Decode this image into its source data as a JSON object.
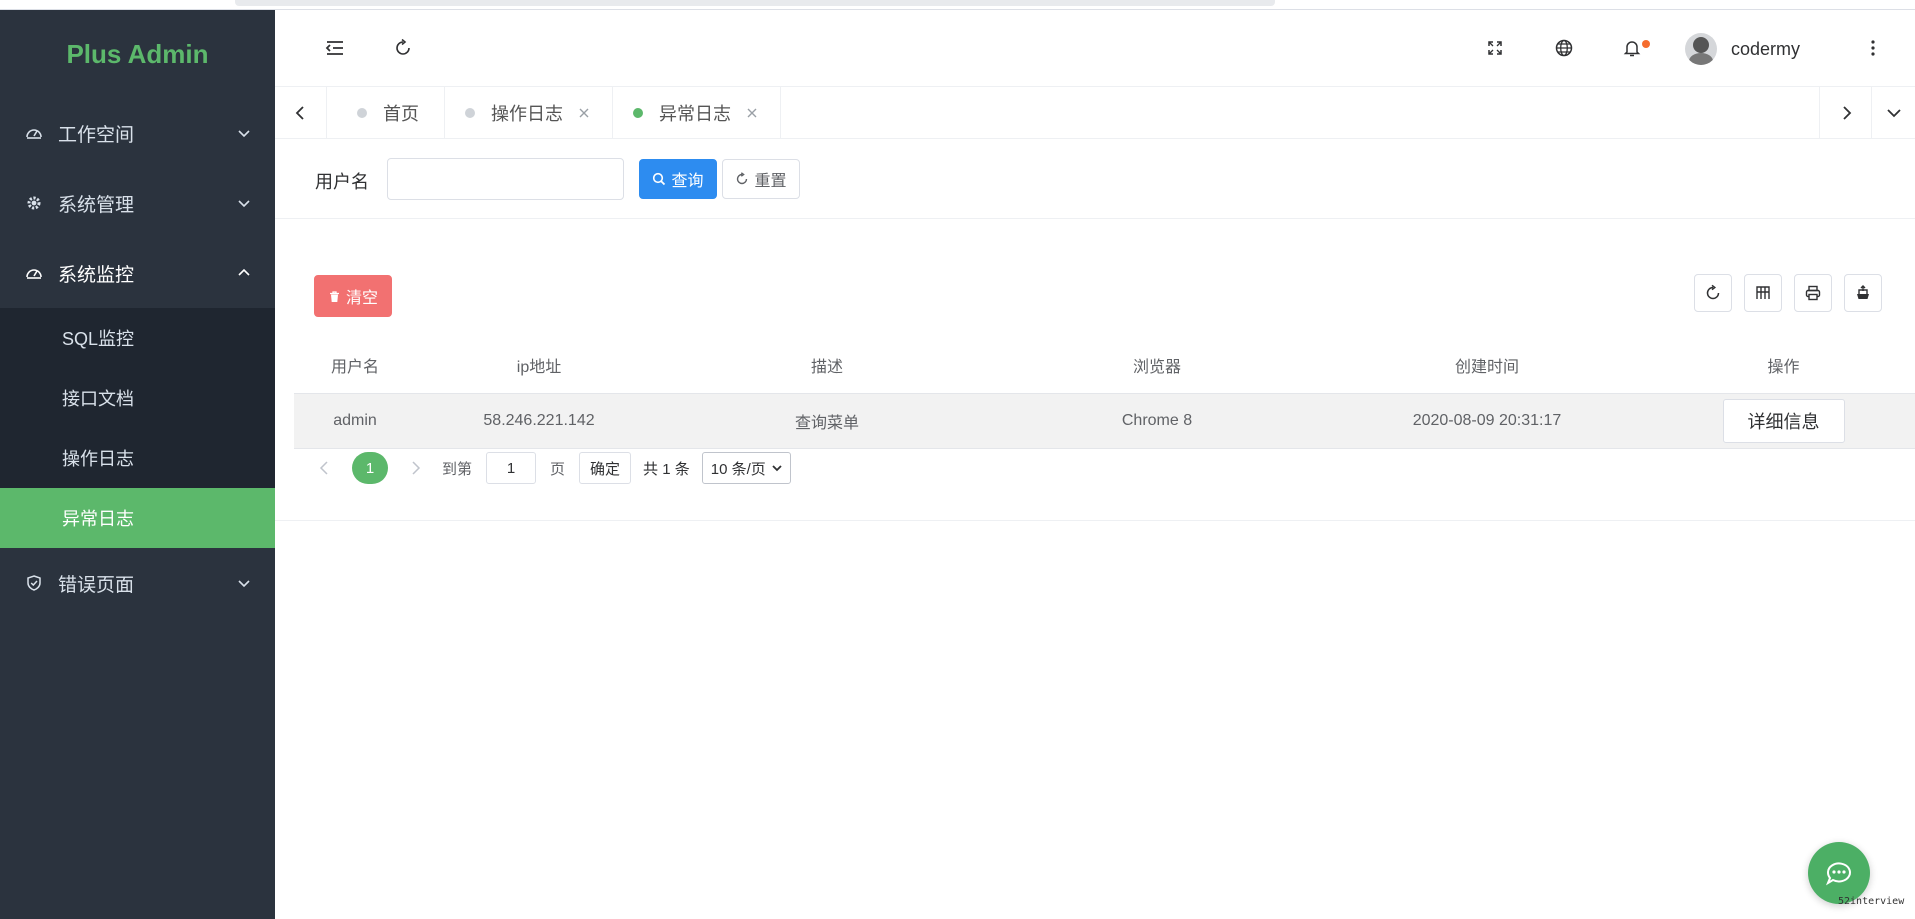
{
  "app": {
    "title": "Plus Admin"
  },
  "sidebar": {
    "items": [
      {
        "label": "工作空间",
        "icon": "dashboard-icon",
        "open": false
      },
      {
        "label": "系统管理",
        "icon": "gear-icon",
        "open": false
      },
      {
        "label": "系统监控",
        "icon": "dashboard-icon",
        "open": true,
        "children": [
          {
            "label": "SQL监控"
          },
          {
            "label": "接口文档"
          },
          {
            "label": "操作日志"
          },
          {
            "label": "异常日志",
            "active": true
          }
        ]
      },
      {
        "label": "错误页面",
        "icon": "shield-icon",
        "open": false
      }
    ]
  },
  "header": {
    "username": "codermy",
    "notification_dot_color": "#f56c2e"
  },
  "tabs": [
    {
      "label": "首页",
      "active": false,
      "closable": false
    },
    {
      "label": "操作日志",
      "active": false,
      "closable": true
    },
    {
      "label": "异常日志",
      "active": true,
      "closable": true
    }
  ],
  "search": {
    "label": "用户名",
    "value": "",
    "query_label": "查询",
    "reset_label": "重置"
  },
  "toolbar": {
    "clear_label": "清空"
  },
  "table": {
    "columns": [
      "用户名",
      "ip地址",
      "描述",
      "浏览器",
      "创建时间",
      "操作"
    ],
    "rows": [
      {
        "username": "admin",
        "ip": "58.246.221.142",
        "description": "查询菜单",
        "browser": "Chrome 8",
        "created": "2020-08-09 20:31:17",
        "action_label": "详细信息"
      }
    ]
  },
  "pagination": {
    "current_page": "1",
    "jump_prefix": "到第",
    "jump_value": "1",
    "jump_suffix": "页",
    "confirm_label": "确定",
    "total_text": "共 1 条",
    "page_size": "10 条/页"
  },
  "watermark": "52interview",
  "colors": {
    "accent": "#5cb86b",
    "sidebar_bg": "#2b333e",
    "primary": "#2d8cf0",
    "danger": "#f27171"
  }
}
